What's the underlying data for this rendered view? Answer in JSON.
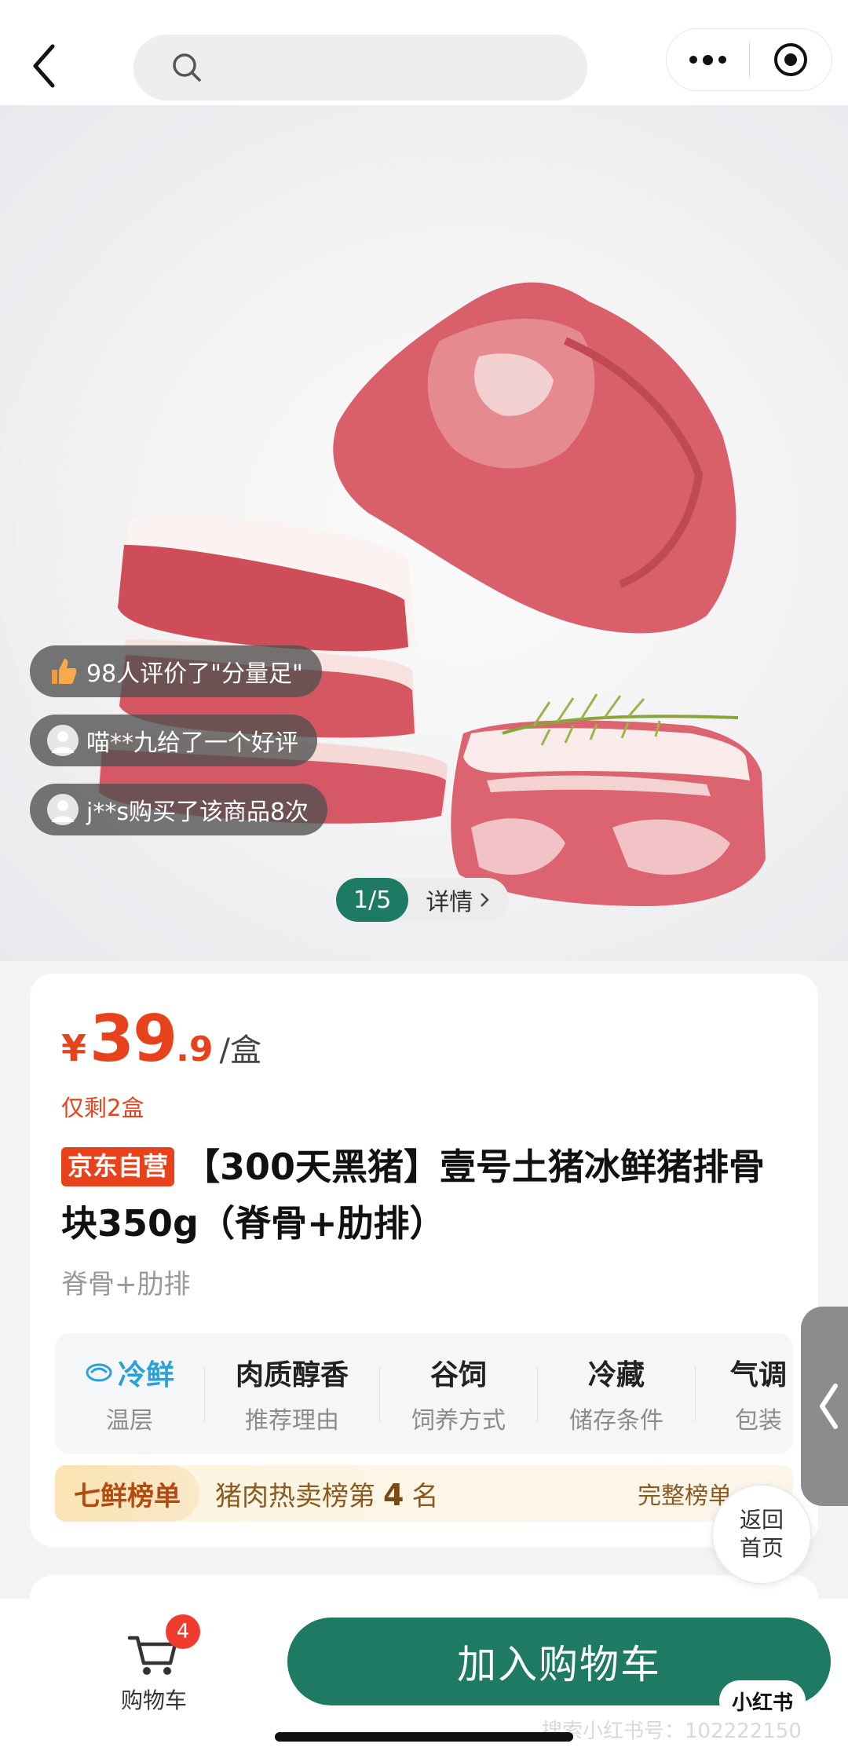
{
  "topbar": {
    "search_placeholder": ""
  },
  "hero": {
    "bubbles": [
      {
        "text": "98人评价了\"分量足\""
      },
      {
        "text": "喵**九给了一个好评"
      },
      {
        "text": "j**s购买了该商品8次"
      }
    ],
    "pager": {
      "index": "1/5",
      "detail_label": "详情"
    }
  },
  "product": {
    "price_currency": "¥",
    "price_integer": "39",
    "price_decimal": ".9",
    "price_unit": "/盒",
    "stock_text": "仅剩2盒",
    "badge": "京东自营",
    "title": "【300天黑猪】壹号土猪冰鲜猪排骨块350g（脊骨+肋排）",
    "subtitle": "脊骨+肋排",
    "attributes": [
      {
        "value": "冷鲜",
        "key": "温层"
      },
      {
        "value": "肉质醇香",
        "key": "推荐理由"
      },
      {
        "value": "谷饲",
        "key": "饲养方式"
      },
      {
        "value": "冷藏",
        "key": "储存条件"
      },
      {
        "value": "气调",
        "key": "包装"
      }
    ],
    "rank": {
      "tag": "七鲜榜单",
      "text_prefix": "猪肉热卖榜第",
      "number": "4",
      "text_suffix": "名",
      "full_label": "完整榜单"
    }
  },
  "side": {
    "home_line1": "返回",
    "home_line2": "首页"
  },
  "bottombar": {
    "cart_label": "购物车",
    "cart_count": "4",
    "add_to_cart_label": "加入购物车",
    "xhs_label": "小红书",
    "watermark": "搜索小红书号：102222150"
  },
  "colors": {
    "brand_green": "#1e7a63",
    "price_red": "#e8421d",
    "badge_red": "#f03c2e"
  }
}
